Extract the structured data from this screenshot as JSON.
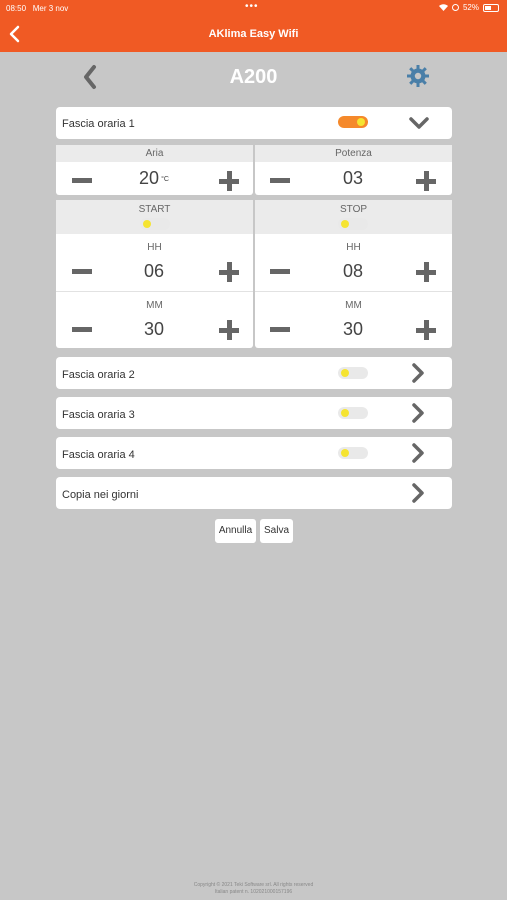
{
  "status_bar": {
    "time": "08:50",
    "date": "Mer 3 nov",
    "battery": "52%"
  },
  "header": {
    "title": "AKlima Easy Wifi"
  },
  "device": {
    "name": "A200"
  },
  "band1": {
    "label": "Fascia oraria 1",
    "enabled": true,
    "aria": {
      "label": "Aria",
      "value": "20",
      "unit": "°C"
    },
    "potenza": {
      "label": "Potenza",
      "value": "03"
    },
    "start": {
      "label": "START",
      "hh_label": "HH",
      "hh": "06",
      "mm_label": "MM",
      "mm": "30"
    },
    "stop": {
      "label": "STOP",
      "hh_label": "HH",
      "hh": "08",
      "mm_label": "MM",
      "mm": "30"
    }
  },
  "bands": [
    {
      "label": "Fascia oraria 2",
      "enabled": false
    },
    {
      "label": "Fascia oraria 3",
      "enabled": false
    },
    {
      "label": "Fascia oraria 4",
      "enabled": false
    }
  ],
  "copy": {
    "label": "Copia nei giorni"
  },
  "buttons": {
    "cancel": "Annulla",
    "save": "Salva"
  },
  "footer": {
    "line1": "Copyright © 2021 Teki Software srl. All rights reserved",
    "line2": "Italian patent n. 102021000157196"
  },
  "colors": {
    "accent": "#f05a24",
    "toggle_on": "#f5892b",
    "knob": "#f5e431",
    "background": "#c7c7c7"
  }
}
